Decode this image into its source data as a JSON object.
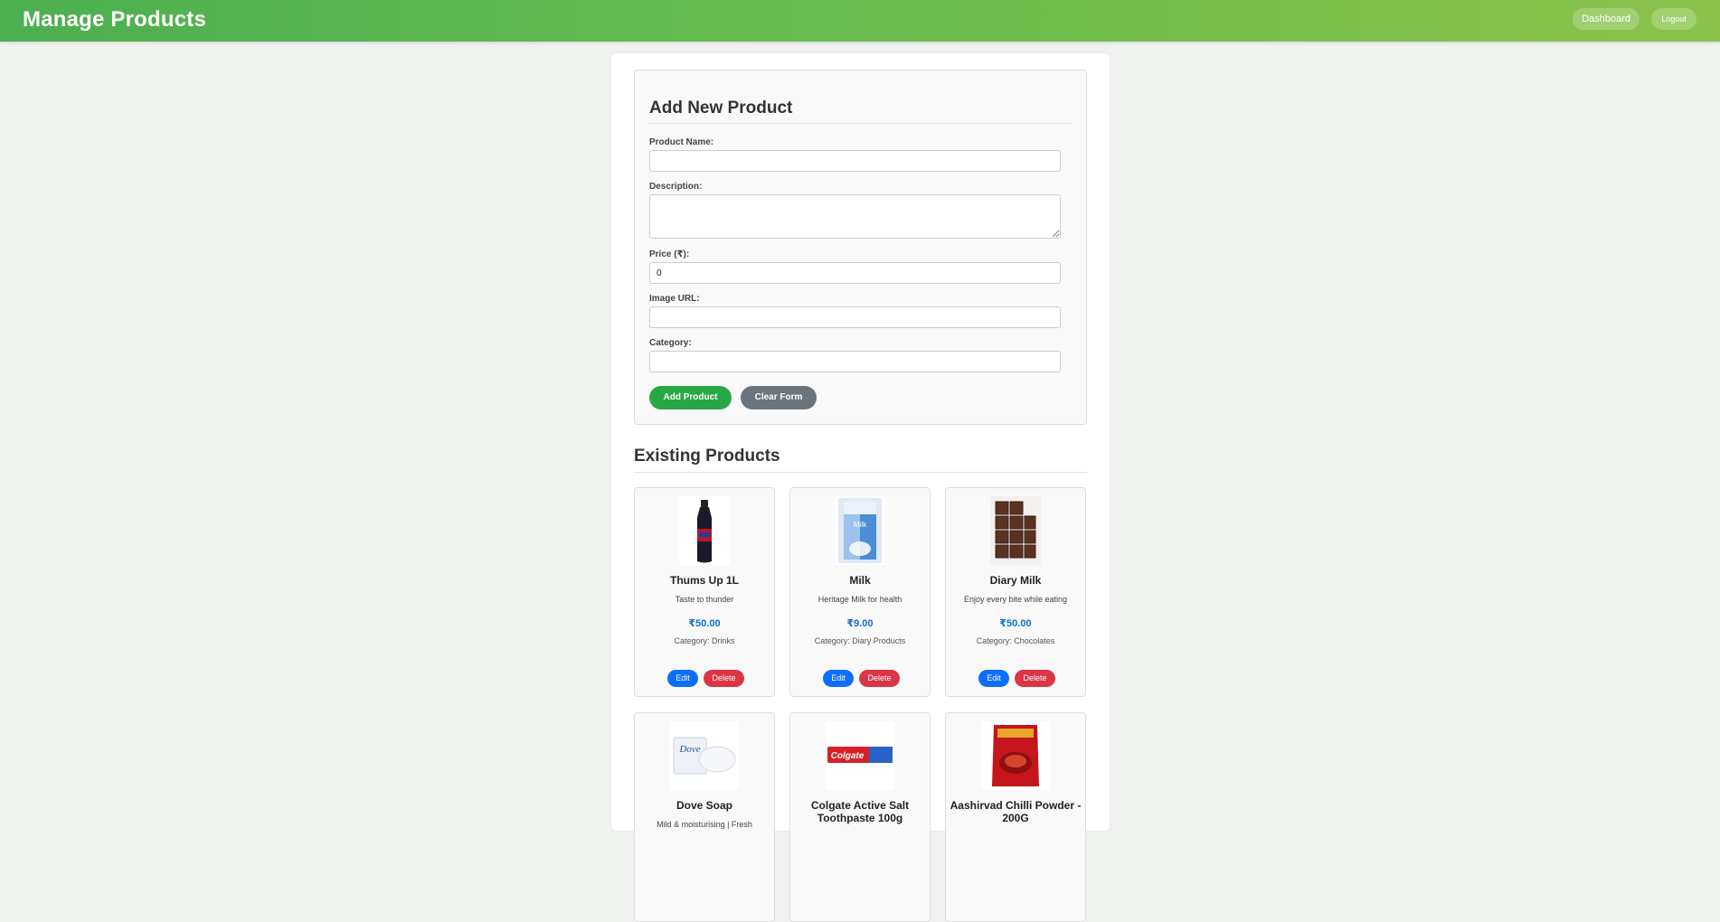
{
  "header": {
    "title": "Manage Products",
    "dashboard_label": "Dashboard",
    "logout_label": "Logout"
  },
  "form": {
    "title": "Add New Product",
    "name_label": "Product Name:",
    "name_value": "",
    "description_label": "Description:",
    "description_value": "",
    "price_label": "Price (₹):",
    "price_value": "0",
    "image_label": "Image URL:",
    "image_value": "",
    "category_label": "Category:",
    "category_value": "",
    "add_label": "Add Product",
    "clear_label": "Clear Form"
  },
  "existing": {
    "title": "Existing Products",
    "edit_label": "Edit",
    "delete_label": "Delete",
    "products": [
      {
        "name": "Thums Up 1L",
        "description": "Taste to thunder",
        "price": "₹50.00",
        "category": "Category: Drinks"
      },
      {
        "name": "Milk",
        "description": "Heritage Milk for health",
        "price": "₹9.00",
        "category": "Category: Diary Products"
      },
      {
        "name": "Diary Milk",
        "description": "Enjoy every bite while eating",
        "price": "₹50.00",
        "category": "Category: Chocolates"
      },
      {
        "name": "Dove Soap",
        "description": "Mild & moisturising | Fresh"
      },
      {
        "name": "Colgate Active Salt Toothpaste 100g"
      },
      {
        "name": "Aashirvad Chilli Powder - 200G"
      }
    ]
  }
}
